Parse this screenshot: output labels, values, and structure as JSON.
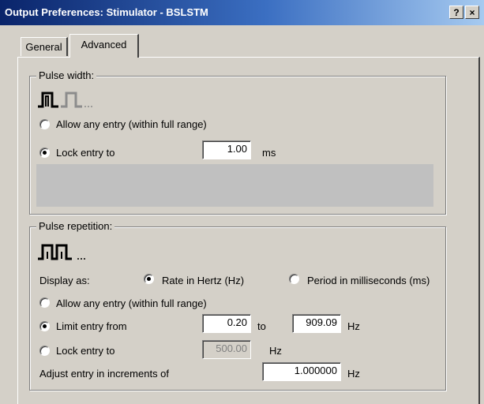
{
  "window": {
    "title": "Output Preferences:  Stimulator - BSLSTM",
    "help_button": "?",
    "close_button": "×"
  },
  "tabs": [
    {
      "label": "General",
      "active": false
    },
    {
      "label": "Advanced",
      "active": true
    }
  ],
  "pulse_width": {
    "legend": "Pulse width:",
    "icon": "pulse-width-icon",
    "allow_any_label": "Allow any entry (within full range)",
    "lock_label": "Lock entry to",
    "lock_value": "1.00",
    "lock_unit": "ms",
    "selected": "lock"
  },
  "pulse_repetition": {
    "legend": "Pulse repetition:",
    "icon": "pulse-repetition-icon",
    "display_as_label": "Display as:",
    "rate_label": "Rate in Hertz (Hz)",
    "period_label": "Period in milliseconds (ms)",
    "display_selected": "rate",
    "allow_any_label": "Allow any entry (within full range)",
    "limit_label": "Limit entry from",
    "limit_from": "0.20",
    "limit_to_label": "to",
    "limit_to": "909.09",
    "limit_unit": "Hz",
    "lock_label": "Lock entry to",
    "lock_value": "500.00",
    "lock_unit": "Hz",
    "entry_selected": "limit",
    "increment_label": "Adjust entry in increments of",
    "increment_value": "1.000000",
    "increment_unit": "Hz"
  },
  "colors": {
    "titlebar_start": "#0a246a",
    "titlebar_end": "#a6caf0",
    "face": "#d4d0c8"
  }
}
